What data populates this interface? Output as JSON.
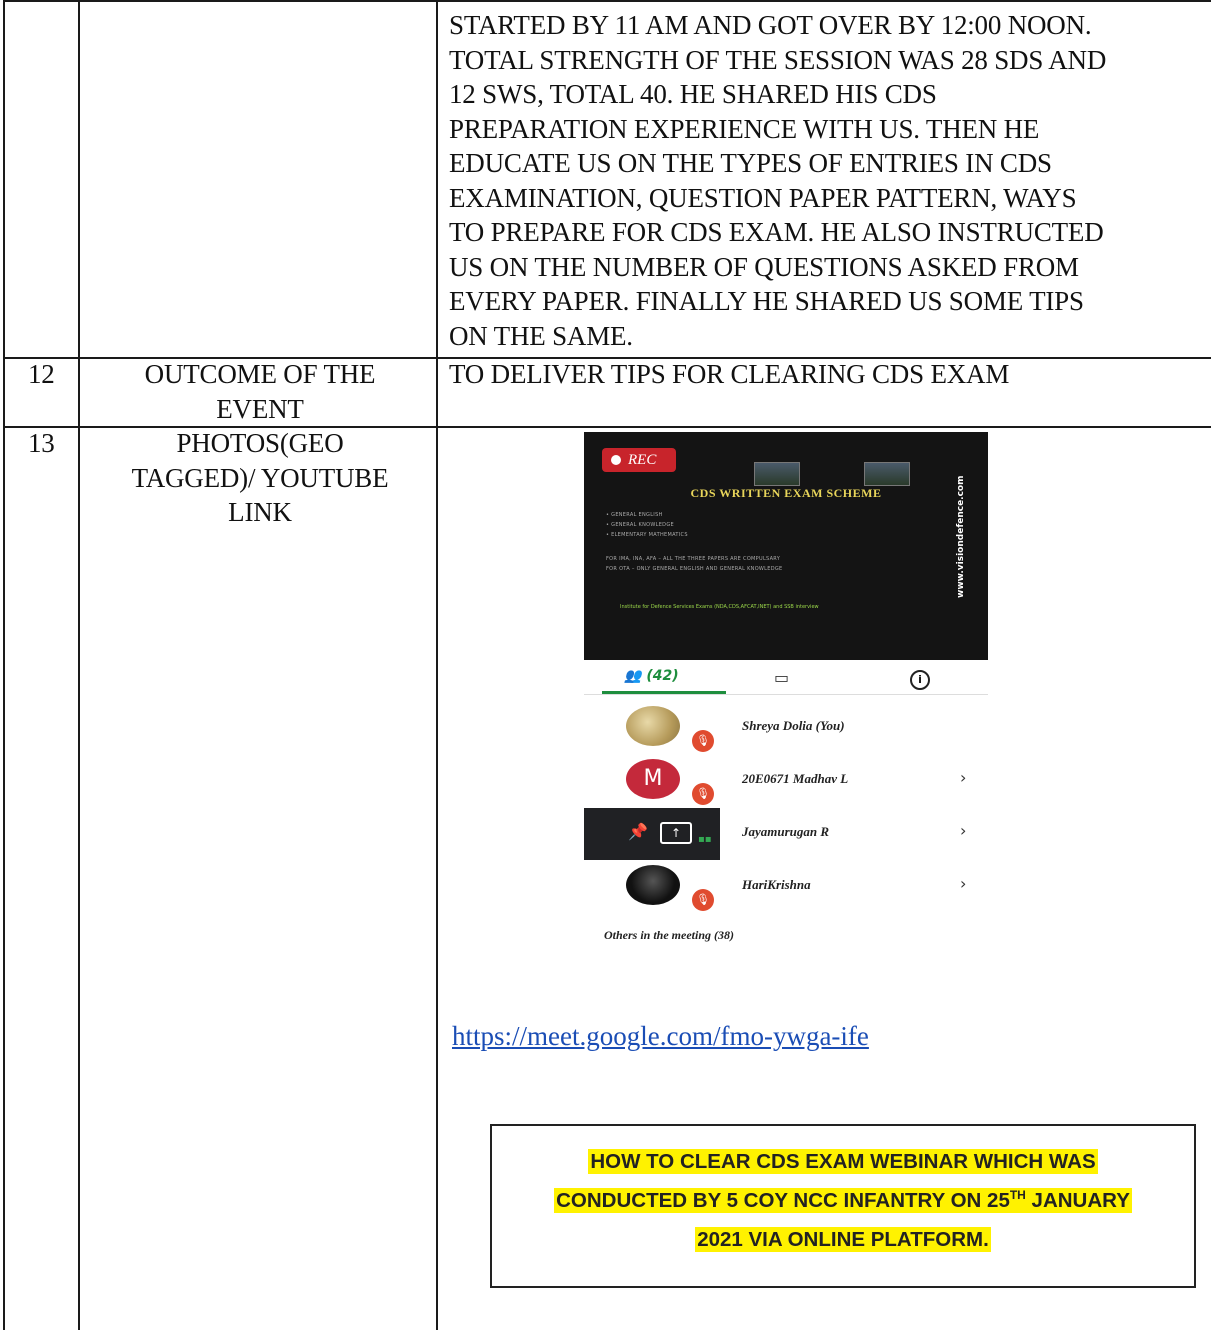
{
  "row11": {
    "lines": [
      "STARTED BY 11 AM AND GOT OVER BY 12:00 NOON.",
      "TOTAL STRENGTH OF THE SESSION WAS 28 SDS AND",
      "12 SWS, TOTAL 40. HE SHARED HIS CDS",
      "PREPARATION EXPERIENCE WITH US. THEN HE",
      "EDUCATE US ON THE TYPES OF ENTRIES IN CDS",
      "EXAMINATION, QUESTION PAPER PATTERN, WAYS",
      "TO PREPARE FOR CDS EXAM. HE ALSO INSTRUCTED",
      "US ON THE NUMBER OF QUESTIONS ASKED FROM",
      "EVERY PAPER. FINALLY HE SHARED US SOME TIPS",
      "ON THE SAME."
    ]
  },
  "row12": {
    "num": "12",
    "label_line1": "OUTCOME OF THE",
    "label_line2": "EVENT",
    "value": "TO DELIVER TIPS FOR CLEARING CDS EXAM"
  },
  "row13": {
    "num": "13",
    "label_line1": "PHOTOS(GEO",
    "label_line2": "TAGGED)/ YOUTUBE",
    "label_line3": "LINK",
    "link": "https://meet.google.com/fmo-ywga-ife",
    "caption_line1": "HOW TO CLEAR CDS EXAM WEBINAR WHICH WAS",
    "caption_line2a": "CONDUCTED BY 5 COY NCC INFANTRY ON 25",
    "caption_line2_sup": "TH",
    "caption_line2b": " JANUARY",
    "caption_line3": "2021 VIA ONLINE PLATFORM."
  },
  "screenshot": {
    "rec_label": "REC",
    "slide_title": "CDS WRITTEN EXAM SCHEME",
    "slide_list": [
      "• GENERAL ENGLISH",
      "• GENERAL KNOWLEDGE",
      "• ELEMENTARY MATHEMATICS"
    ],
    "slide_note1": "FOR IMA, INA, AFA – ALL THE THREE PAPERS ARE COMPULSARY",
    "slide_note2": "FOR OTA – ONLY GENERAL ENGLISH AND GENERAL KNOWLEDGE",
    "slide_footer": "Institute for Defence Services Exams (NDA,CDS,AFCAT,INET) and SSB interview",
    "slide_vertical": "www.visiondefence.com",
    "people_tab": "(42)",
    "participants": [
      {
        "name": "Shreya Dolia (You)"
      },
      {
        "name": "20E0671 Madhav L",
        "initial": "M"
      },
      {
        "name": "Jayamurugan R"
      },
      {
        "name": "HariKrishna"
      }
    ],
    "others": "Others in the meeting (38)"
  },
  "colors": {
    "highlight": "#fff200",
    "link": "#1a4db5",
    "meet_green": "#1e8e3e",
    "mute_red": "#e04b2f"
  }
}
